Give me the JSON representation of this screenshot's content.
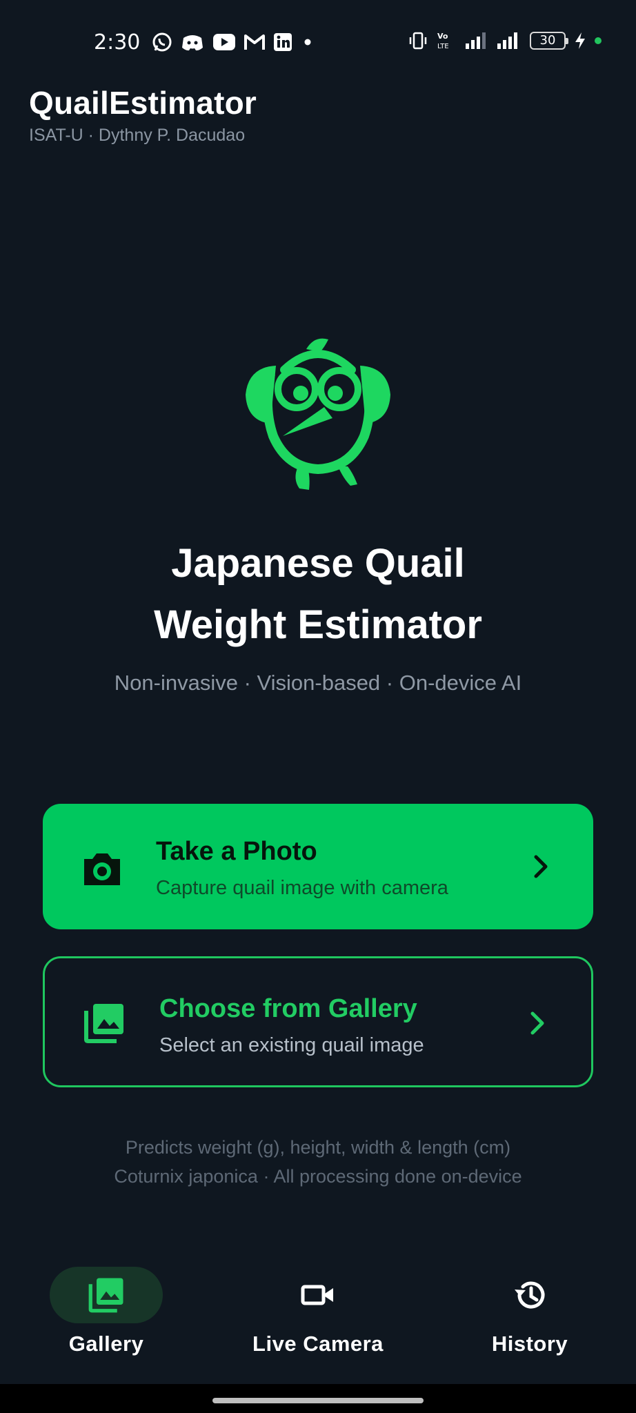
{
  "status_bar": {
    "time": "2:30",
    "battery_level": "30",
    "notification_icons": [
      "whatsapp-icon",
      "discord-icon",
      "youtube-icon",
      "gmail-icon",
      "linkedin-icon",
      "dot-icon"
    ],
    "system_icons": [
      "vibrate-icon",
      "volte-icon",
      "signal-icon",
      "signal-icon",
      "battery-icon",
      "charging-icon"
    ]
  },
  "header": {
    "title": "QuailEstimator",
    "subtitle": "ISAT-U · Dythny P. Dacudao"
  },
  "hero": {
    "logo_icon": "quail-logo-icon",
    "title_line1": "Japanese Quail",
    "title_line2": "Weight Estimator",
    "tagline": "Non-invasive · Vision-based · On-device AI"
  },
  "actions": {
    "take_photo": {
      "title": "Take a Photo",
      "description": "Capture quail image with camera",
      "icon": "camera-icon"
    },
    "gallery": {
      "title": "Choose from Gallery",
      "description": "Select an existing quail image",
      "icon": "photo-library-icon"
    }
  },
  "footer": {
    "line1": "Predicts weight (g), height, width & length (cm)",
    "line2": "Coturnix japonica · All processing done on-device"
  },
  "nav": {
    "items": [
      {
        "label": "Gallery",
        "icon": "photo-library-icon",
        "active": true
      },
      {
        "label": "Live Camera",
        "icon": "videocam-icon",
        "active": false
      },
      {
        "label": "History",
        "icon": "history-icon",
        "active": false
      }
    ]
  },
  "colors": {
    "background": "#0f1720",
    "accent": "#00c85e",
    "accent_border": "#1fc75f",
    "nav_active_pill": "#173528",
    "muted_text": "#8b96a3"
  }
}
